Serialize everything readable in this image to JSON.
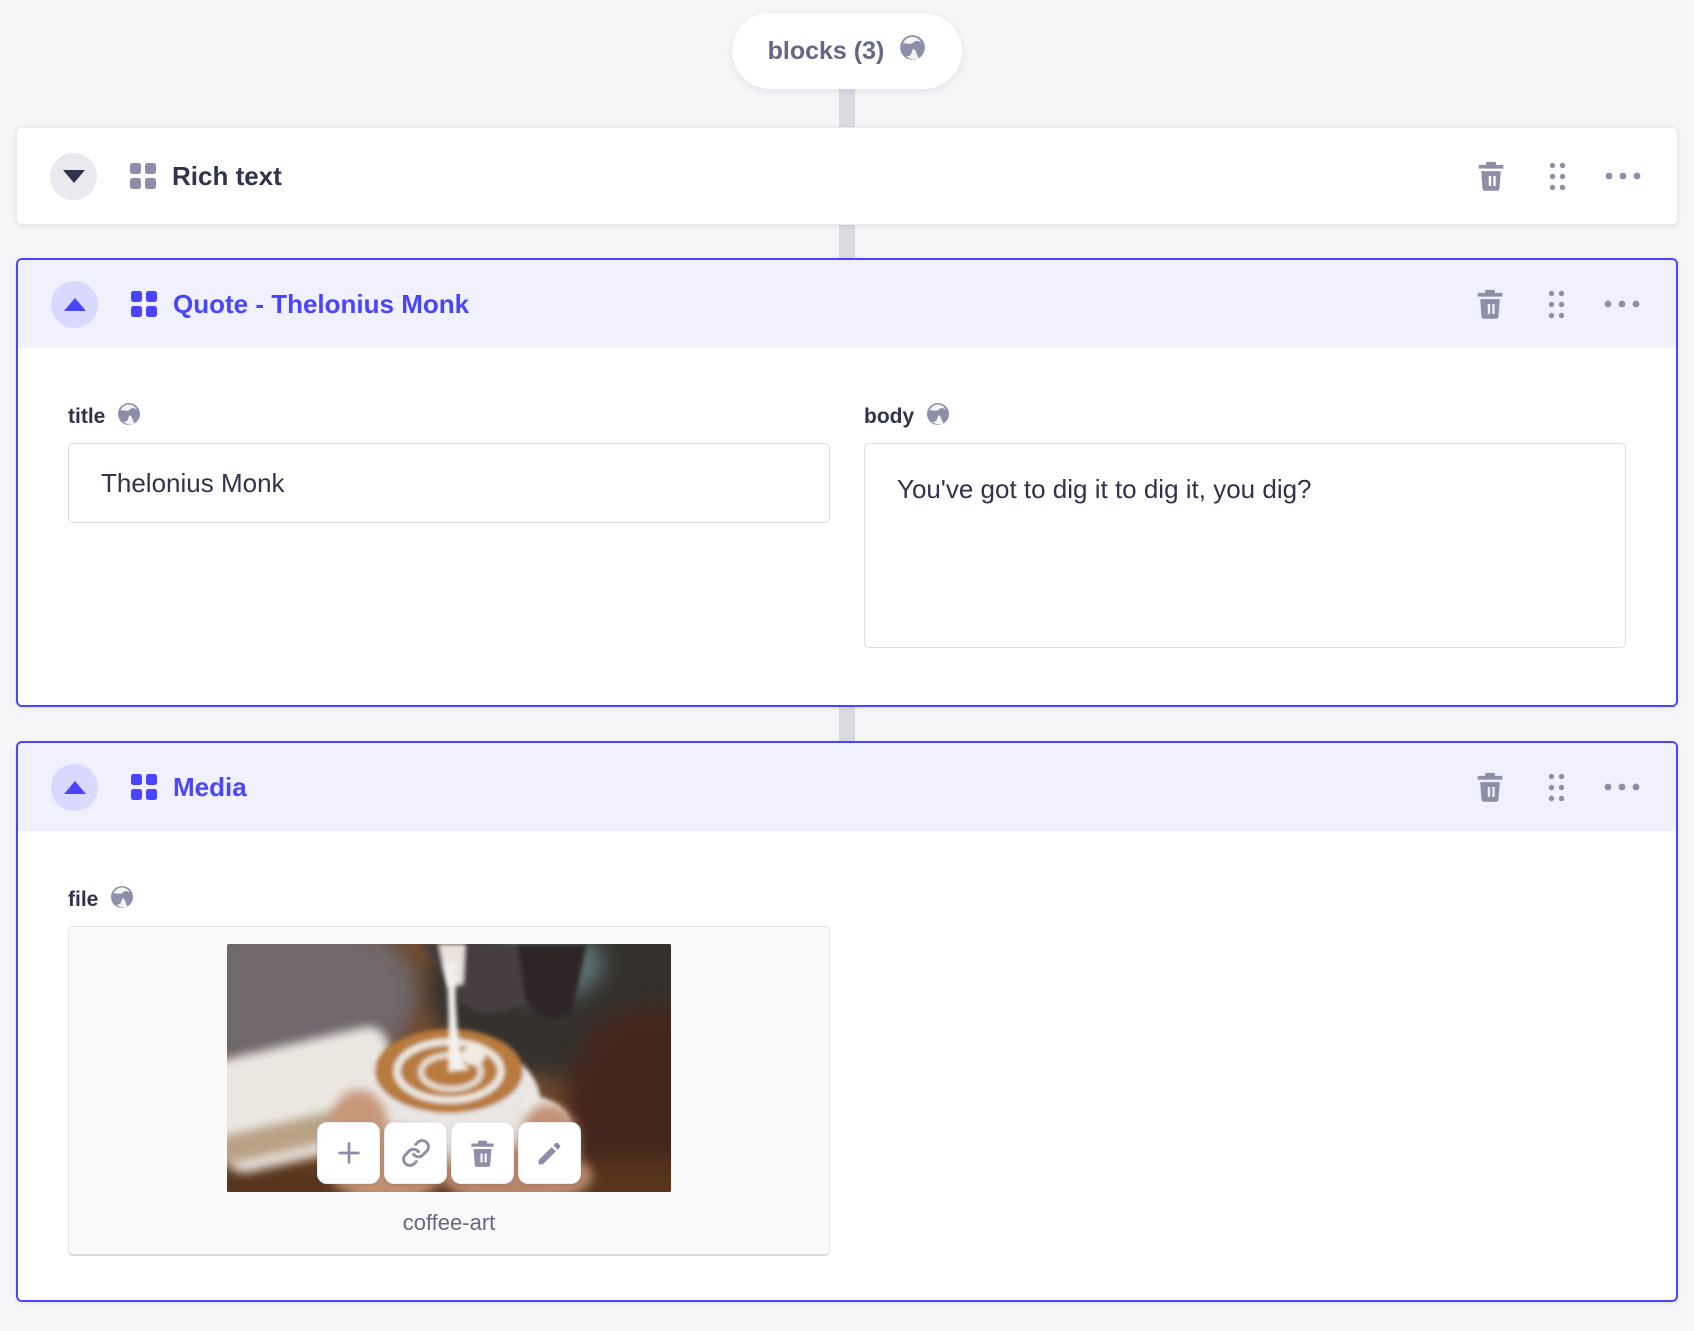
{
  "pill": {
    "label": "blocks (3)",
    "icon": "globe-icon"
  },
  "blocks": [
    {
      "title": "Rich text",
      "state": "collapsed"
    },
    {
      "title": "Quote - Thelonius Monk",
      "state": "expanded",
      "fields": {
        "title": {
          "label": "title",
          "value": "Thelonius Monk",
          "localized": true
        },
        "body": {
          "label": "body",
          "value": "You've got to dig it to dig it, you dig?",
          "localized": true
        }
      }
    },
    {
      "title": "Media",
      "state": "expanded",
      "fields": {
        "file": {
          "label": "file",
          "filename": "coffee-art",
          "localized": true
        }
      }
    }
  ],
  "header_action_icons": [
    "trash-icon",
    "drag-handle-icon",
    "more-options-icon"
  ],
  "media_toolbar_icons": [
    "add-icon",
    "copy-link-icon",
    "trash-icon",
    "edit-icon"
  ],
  "colors": {
    "primary": "#4945ff",
    "primary_header_bg": "#f0f0ff",
    "primary_toggle_bg": "#d9d8ff",
    "page_bg": "#f6f6f9",
    "text_dark": "#32324d",
    "text_muted": "#666687",
    "icon_gray": "#8e8ea9",
    "input_border": "#dcdce4",
    "connector": "#dadae3"
  }
}
